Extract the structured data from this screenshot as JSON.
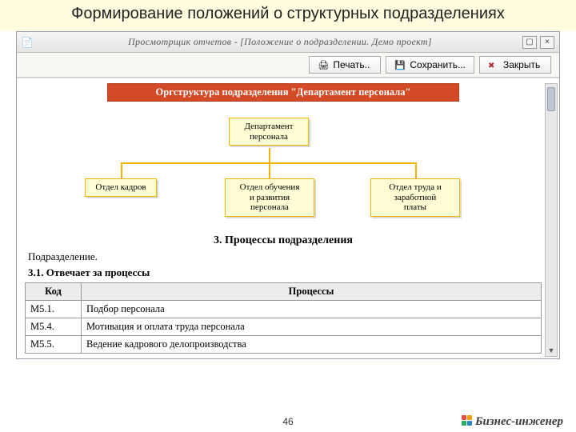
{
  "slide": {
    "title": "Формирование положений о структурных подразделениях",
    "number": "46"
  },
  "app": {
    "window_title": "Просмотрщик отчетов - [Положение о подразделении. Демо проект]",
    "toolbar": {
      "print": "Печать..",
      "save": "Сохранить...",
      "close": "Закрыть"
    }
  },
  "doc": {
    "orgstructure_header": "Оргструктура подразделения \"Департамент персонала\"",
    "nodes": {
      "root": "Департамент\nперсонала",
      "n1": "Отдел кадров",
      "n2": "Отдел обучения\nи развития\nперсонала",
      "n3": "Отдел труда и\nзаработной\nплаты"
    },
    "section3_title": "3. Процессы подразделения",
    "subdivision_label": "Подразделение.",
    "section31": "3.1. Отвечает за процессы",
    "table": {
      "headers": {
        "code": "Код",
        "process": "Процессы"
      },
      "rows": [
        {
          "code": "М5.1.",
          "name": "Подбор персонала"
        },
        {
          "code": "М5.4.",
          "name": "Мотивация и оплата труда персонала"
        },
        {
          "code": "М5.5.",
          "name": "Ведение кадрового делопроизводства"
        }
      ]
    }
  },
  "brand": {
    "name": "Бизнес-инженер"
  }
}
